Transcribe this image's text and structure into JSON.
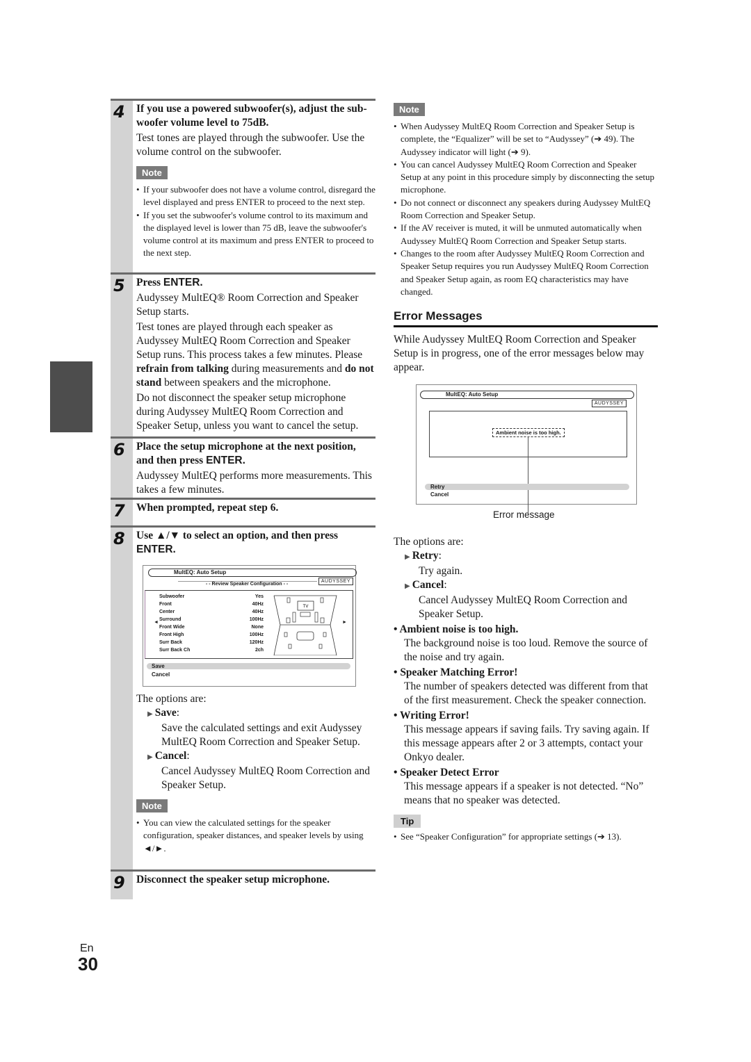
{
  "page": {
    "lang": "En",
    "number": "30"
  },
  "steps": [
    {
      "num": "4",
      "title": "If you use a powered subwoofer(s), adjust the sub-woofer volume level to 75dB.",
      "text": "Test tones are played through the subwoofer. Use the volume control on the subwoofer.",
      "note_label": "Note",
      "notes": [
        "If your subwoofer does not have a volume control, disregard the level displayed and press ENTER to proceed to the next step.",
        "If you set the subwoofer's volume control to its maximum and the displayed level is lower than 75 dB, leave the subwoofer's volume control at its maximum and press ENTER to proceed to the next step."
      ]
    },
    {
      "num": "5",
      "title_prefix": "Press ",
      "title_key": "ENTER.",
      "p1": "Audyssey MultEQ® Room Correction and Speaker Setup starts.",
      "p2a": "Test tones are played through each speaker as Audyssey MultEQ Room Correction and Speaker Setup runs. This process takes a few minutes. Please ",
      "p2b": "refrain from talking",
      "p2c": " during measurements and ",
      "p2d": "do not stand",
      "p2e": " between speakers and the microphone.",
      "p3": "Do not disconnect the speaker setup microphone during Audyssey MultEQ Room Correction and Speaker Setup, unless you want to cancel the setup."
    },
    {
      "num": "6",
      "title": "Place the setup microphone at the next position, and then press ",
      "title_key": "ENTER.",
      "text": "Audyssey MultEQ performs more measurements. This takes a few minutes."
    },
    {
      "num": "7",
      "title": "When prompted, repeat step 6."
    },
    {
      "num": "8",
      "title": "Use ▲/▼ to select an option, and then press ",
      "title_key": "ENTER.",
      "options_intro": "The options are:",
      "options": [
        {
          "label": "Save",
          "desc": "Save the calculated settings and exit Audyssey MultEQ Room Correction and Speaker Setup."
        },
        {
          "label": "Cancel",
          "desc": "Cancel Audyssey MultEQ Room Correction and Speaker Setup."
        }
      ],
      "note_label": "Note",
      "notes": [
        "You can view the calculated settings for the speaker configuration, speaker distances, and speaker levels by using ◄/►."
      ]
    },
    {
      "num": "9",
      "title": "Disconnect the speaker setup microphone."
    }
  ],
  "review_screen": {
    "title": "MultEQ: Auto Setup",
    "subtitle": "- -  Review Speaker Configuration  - -",
    "logo": "AUDYSSEY",
    "rows": [
      {
        "name": "Subwoofer",
        "value": "Yes"
      },
      {
        "name": "Front",
        "value": "40Hz"
      },
      {
        "name": "Center",
        "value": "40Hz"
      },
      {
        "name": "Surround",
        "value": "100Hz"
      },
      {
        "name": "Front Wide",
        "value": "None"
      },
      {
        "name": "Front High",
        "value": "100Hz"
      },
      {
        "name": "Surr Back",
        "value": "120Hz"
      },
      {
        "name": "Surr Back Ch",
        "value": "2ch"
      }
    ],
    "tv_label": "TV",
    "menu": [
      "Save",
      "Cancel"
    ],
    "selected": "Save"
  },
  "right": {
    "note_label": "Note",
    "notes": [
      "When Audyssey MultEQ Room Correction and Speaker Setup is complete, the “Equalizer” will be set to “Audyssey” (➔ 49). The Audyssey indicator will light (➔ 9).",
      "You can cancel Audyssey MultEQ Room Correction and Speaker Setup at any point in this procedure simply by disconnecting the setup microphone.",
      "Do not connect or disconnect any speakers during Audyssey MultEQ Room Correction and Speaker Setup.",
      "If the AV receiver is muted, it will be unmuted automatically when Audyssey MultEQ Room Correction and Speaker Setup starts.",
      "Changes to the room after Audyssey MultEQ Room Correction and Speaker Setup requires you run Audyssey MultEQ Room Correction and Speaker Setup again, as room EQ characteristics may have changed."
    ],
    "section_title": "Error Messages",
    "intro": "While Audyssey MultEQ Room Correction and Speaker Setup is in progress, one of the error messages below may appear.",
    "error_screen": {
      "title": "MultEQ: Auto Setup",
      "logo": "AUDYSSEY",
      "message": "Ambient noise is too high.",
      "menu": [
        "Retry",
        "Cancel"
      ],
      "selected": "Retry",
      "callout": "Error message"
    },
    "options_intro": "The options are:",
    "options": [
      {
        "label": "Retry",
        "desc": "Try again."
      },
      {
        "label": "Cancel",
        "desc": "Cancel Audyssey MultEQ Room Correction and Speaker Setup."
      }
    ],
    "errors": [
      {
        "title": "Ambient noise is too high.",
        "desc": "The background noise is too loud. Remove the source of the noise and try again."
      },
      {
        "title": "Speaker Matching Error!",
        "desc": "The number of speakers detected was different from that of the first measurement. Check the speaker connection."
      },
      {
        "title": "Writing Error!",
        "desc": "This message appears if saving fails. Try saving again. If this message appears after 2 or 3 attempts, contact your Onkyo dealer."
      },
      {
        "title": "Speaker Detect Error",
        "desc": "This message appears if a speaker is not detected. “No” means that no speaker was detected."
      }
    ],
    "tip_label": "Tip",
    "tip": "See “Speaker Configuration” for appropriate settings (➔ 13)."
  }
}
